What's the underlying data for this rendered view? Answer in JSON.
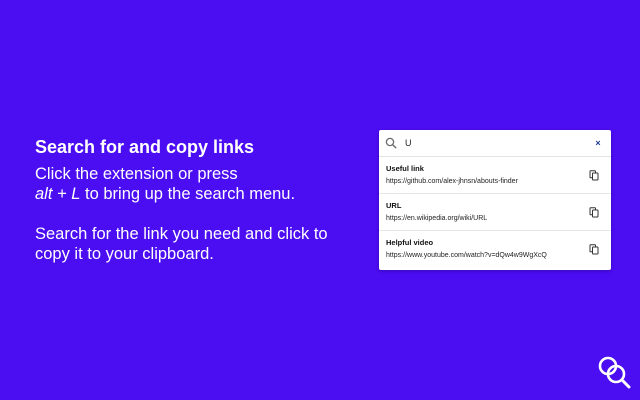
{
  "colors": {
    "background": "#4b0df2",
    "text": "#ffffff",
    "popup_bg": "#ffffff",
    "clear_icon": "#1b3a8c"
  },
  "promo": {
    "title": "Search for and copy links",
    "line1": "Click the extension or press",
    "shortcut": "alt + L",
    "line2": "to bring up the search menu.",
    "paragraph2": "Search for the link you need and click to copy it to your clipboard."
  },
  "popup": {
    "search": {
      "value": "U",
      "icon": "search-icon",
      "clear_label": "×"
    },
    "results": [
      {
        "title": "Useful link",
        "url": "https://github.com/alex-jhnsn/abouts-finder",
        "icon": "copy-icon"
      },
      {
        "title": "URL",
        "url": "https://en.wikipedia.org/wiki/URL",
        "icon": "copy-icon"
      },
      {
        "title": "Helpful video",
        "url": "https://www.youtube.com/watch?v=dQw4w9WgXcQ",
        "icon": "copy-icon"
      }
    ]
  },
  "logo": {
    "icon": "links-search-logo-icon"
  }
}
